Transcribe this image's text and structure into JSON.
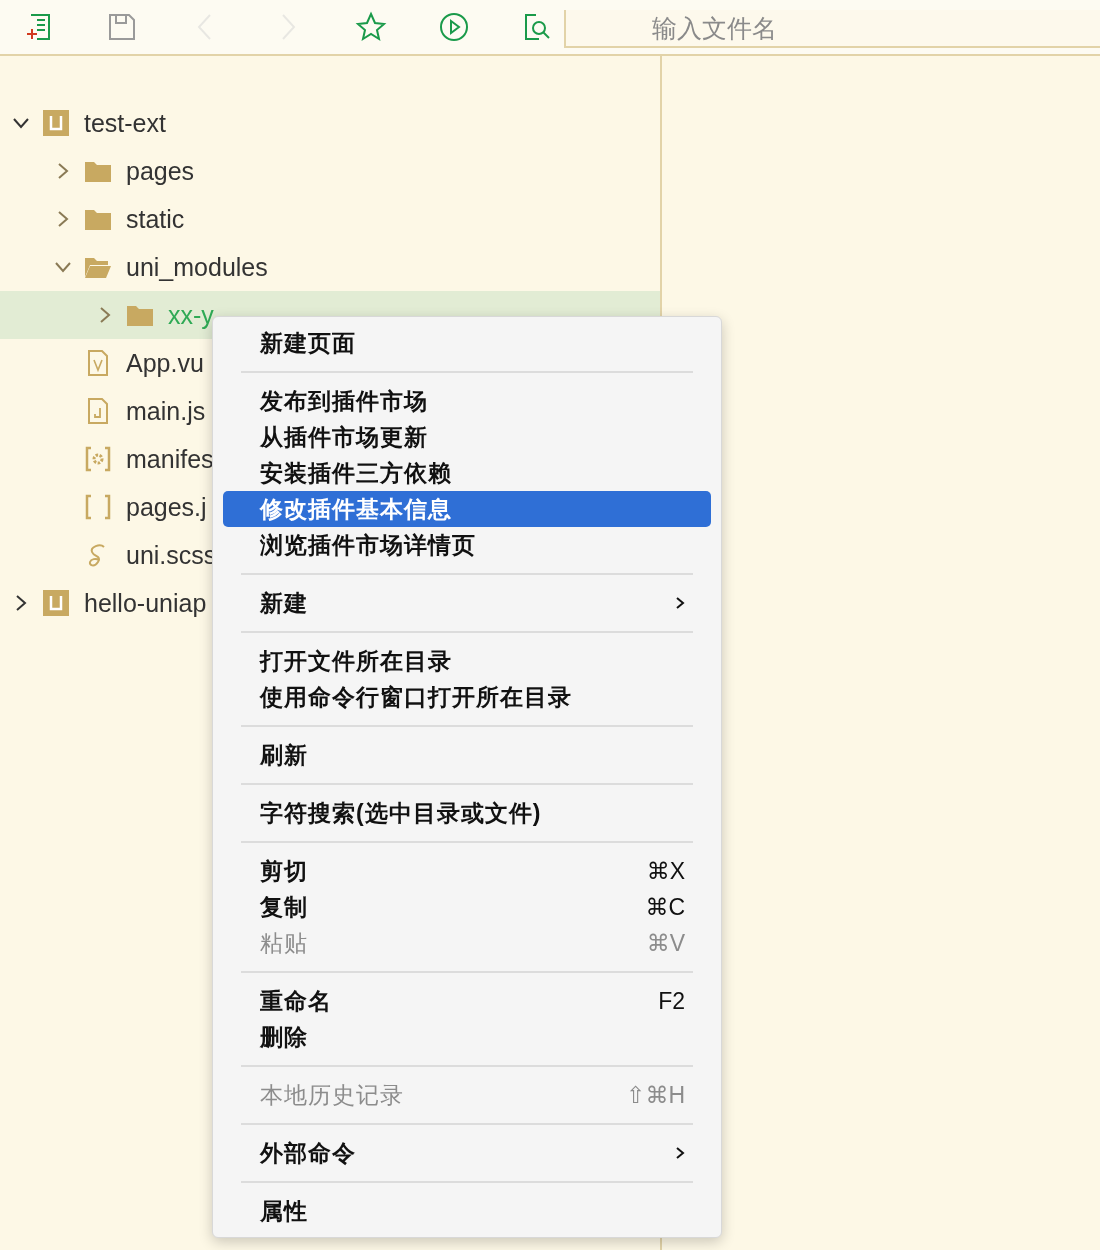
{
  "toolbar": {
    "buttons": [
      {
        "kind": "new-file",
        "disabled": false
      },
      {
        "kind": "save",
        "disabled": false
      },
      {
        "kind": "back",
        "disabled": true
      },
      {
        "kind": "forward",
        "disabled": true
      },
      {
        "kind": "favorite",
        "disabled": false
      },
      {
        "kind": "run",
        "disabled": false
      },
      {
        "kind": "find-file",
        "disabled": false
      }
    ],
    "search": {
      "placeholder": "输入文件名"
    }
  },
  "tree": [
    {
      "label": "test-ext",
      "kind": "project",
      "expanded": true,
      "selected": false,
      "children": [
        {
          "label": "pages",
          "kind": "folder",
          "expanded": false,
          "selected": false
        },
        {
          "label": "static",
          "kind": "folder",
          "expanded": false,
          "selected": false
        },
        {
          "label": "uni_modules",
          "kind": "folder",
          "expanded": true,
          "selected": false,
          "children": [
            {
              "label": "xx-y",
              "kind": "folder",
              "expanded": false,
              "selected": true
            }
          ]
        },
        {
          "label": "App.vu",
          "kind": "vue",
          "selected": false
        },
        {
          "label": "main.js",
          "kind": "js",
          "selected": false
        },
        {
          "label": "manifes",
          "kind": "settings",
          "selected": false
        },
        {
          "label": "pages.j",
          "kind": "json",
          "selected": false
        },
        {
          "label": "uni.scss",
          "kind": "scss",
          "selected": false
        }
      ]
    },
    {
      "label": "hello-uniap",
      "kind": "project",
      "expanded": false,
      "selected": false
    }
  ],
  "context_menu": {
    "sections": [
      {
        "items": [
          {
            "label": "新建页面",
            "kind": "command",
            "disabled": false,
            "selected": false
          }
        ]
      },
      {
        "items": [
          {
            "label": "发布到插件市场",
            "kind": "command",
            "disabled": false,
            "selected": false
          },
          {
            "label": "从插件市场更新",
            "kind": "command",
            "disabled": false,
            "selected": false
          },
          {
            "label": "安装插件三方依赖",
            "kind": "command",
            "disabled": false,
            "selected": false
          },
          {
            "label": "修改插件基本信息",
            "kind": "command",
            "disabled": false,
            "selected": true
          },
          {
            "label": "浏览插件市场详情页",
            "kind": "command",
            "disabled": false,
            "selected": false
          }
        ]
      },
      {
        "items": [
          {
            "label": "新建",
            "kind": "submenu",
            "disabled": false,
            "selected": false
          }
        ]
      },
      {
        "items": [
          {
            "label": "打开文件所在目录",
            "kind": "command",
            "disabled": false,
            "selected": false
          },
          {
            "label": "使用命令行窗口打开所在目录",
            "kind": "command",
            "disabled": false,
            "selected": false
          }
        ]
      },
      {
        "items": [
          {
            "label": "刷新",
            "kind": "command",
            "disabled": false,
            "selected": false
          }
        ]
      },
      {
        "items": [
          {
            "label": "字符搜索(选中目录或文件)",
            "kind": "command",
            "disabled": false,
            "selected": false
          }
        ]
      },
      {
        "items": [
          {
            "label": "剪切",
            "kind": "command",
            "shortcut": "⌘X",
            "disabled": false,
            "selected": false
          },
          {
            "label": "复制",
            "kind": "command",
            "shortcut": "⌘C",
            "disabled": false,
            "selected": false
          },
          {
            "label": "粘贴",
            "kind": "command",
            "shortcut": "⌘V",
            "disabled": true,
            "selected": false
          }
        ]
      },
      {
        "items": [
          {
            "label": "重命名",
            "kind": "command",
            "shortcut": "F2",
            "disabled": false,
            "selected": false
          },
          {
            "label": "删除",
            "kind": "command",
            "disabled": false,
            "selected": false
          }
        ]
      },
      {
        "items": [
          {
            "label": "本地历史记录",
            "kind": "command",
            "shortcut": "⇧⌘H",
            "disabled": true,
            "selected": false
          }
        ]
      },
      {
        "items": [
          {
            "label": "外部命令",
            "kind": "submenu",
            "disabled": false,
            "selected": false
          }
        ]
      },
      {
        "items": [
          {
            "label": "属性",
            "kind": "command",
            "disabled": false,
            "selected": false
          }
        ]
      }
    ]
  }
}
